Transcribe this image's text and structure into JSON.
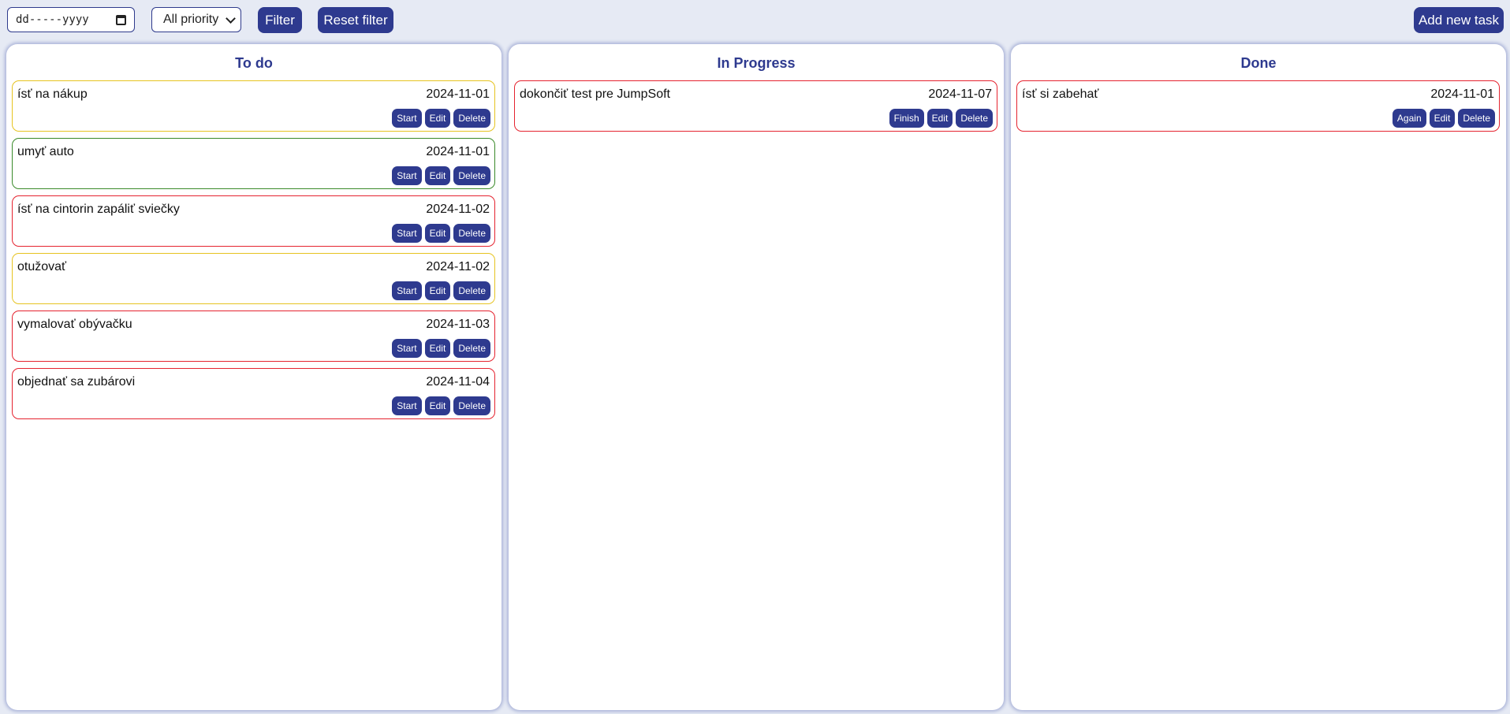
{
  "toolbar": {
    "date_placeholder": "dd-----yyyy",
    "priority_selected": "All priority",
    "filter_label": "Filter",
    "reset_label": "Reset filter",
    "add_label": "Add new task"
  },
  "columns": [
    {
      "title": "To do",
      "tasks": [
        {
          "title": "ísť na nákup",
          "date": "2024-11-01",
          "priority_color": "#e6c320",
          "actions": [
            "Start",
            "Edit",
            "Delete"
          ]
        },
        {
          "title": "umyť auto",
          "date": "2024-11-01",
          "priority_color": "#3a8a2a",
          "actions": [
            "Start",
            "Edit",
            "Delete"
          ]
        },
        {
          "title": "ísť na cintorin zapáliť sviečky",
          "date": "2024-11-02",
          "priority_color": "#e5232f",
          "actions": [
            "Start",
            "Edit",
            "Delete"
          ]
        },
        {
          "title": "otužovať",
          "date": "2024-11-02",
          "priority_color": "#e6c320",
          "actions": [
            "Start",
            "Edit",
            "Delete"
          ]
        },
        {
          "title": "vymalovať obývačku",
          "date": "2024-11-03",
          "priority_color": "#e5232f",
          "actions": [
            "Start",
            "Edit",
            "Delete"
          ]
        },
        {
          "title": "objednať sa zubárovi",
          "date": "2024-11-04",
          "priority_color": "#e5232f",
          "actions": [
            "Start",
            "Edit",
            "Delete"
          ]
        }
      ]
    },
    {
      "title": "In Progress",
      "tasks": [
        {
          "title": "dokončiť test pre JumpSoft",
          "date": "2024-11-07",
          "priority_color": "#e5232f",
          "actions": [
            "Finish",
            "Edit",
            "Delete"
          ]
        }
      ]
    },
    {
      "title": "Done",
      "tasks": [
        {
          "title": "ísť si zabehať",
          "date": "2024-11-01",
          "priority_color": "#e5232f",
          "actions": [
            "Again",
            "Edit",
            "Delete"
          ]
        }
      ]
    }
  ],
  "colors": {
    "accent": "#2e3a8f",
    "background": "#e6eaf4"
  }
}
